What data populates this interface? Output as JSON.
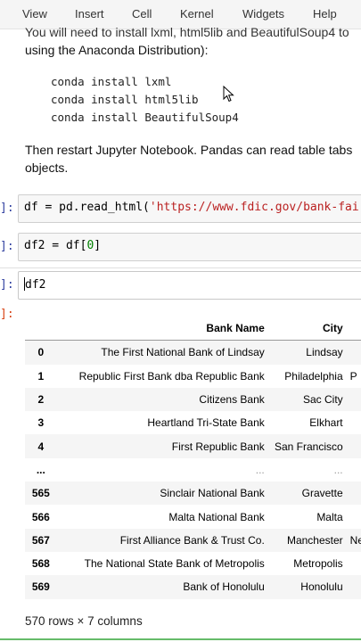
{
  "menu": [
    "View",
    "Insert",
    "Cell",
    "Kernel",
    "Widgets",
    "Help"
  ],
  "markdown": {
    "line1": "You will need to install lxml, html5lib and BeautifulSoup4 to",
    "line2": "using the Anaconda Distribution):",
    "commands": [
      "conda install lxml",
      "conda install html5lib",
      "conda install BeautifulSoup4"
    ],
    "line3": "Then restart Jupyter Notebook. Pandas can read table tabs",
    "line4": "objects."
  },
  "cells": [
    {
      "prompt": "]:",
      "code_var": "df",
      "code_mid": " = pd.read_html(",
      "code_str": "'https://www.fdic.gov/bank-fai"
    },
    {
      "prompt": "]:",
      "code_pre": "df2 = df[",
      "code_num": "0",
      "code_post": "]"
    },
    {
      "prompt": "]:",
      "code": "df2"
    }
  ],
  "output_prompt": "]:",
  "table": {
    "columns": [
      "Bank Name",
      "City"
    ],
    "rows": [
      {
        "index": "0",
        "bank": "The First National Bank of Lindsay",
        "city": "Lindsay",
        "extra": ""
      },
      {
        "index": "1",
        "bank": "Republic First Bank dba Republic Bank",
        "city": "Philadelphia",
        "extra": "P"
      },
      {
        "index": "2",
        "bank": "Citizens Bank",
        "city": "Sac City",
        "extra": ""
      },
      {
        "index": "3",
        "bank": "Heartland Tri-State Bank",
        "city": "Elkhart",
        "extra": ""
      },
      {
        "index": "4",
        "bank": "First Republic Bank",
        "city": "San Francisco",
        "extra": ""
      },
      {
        "index": "...",
        "bank": "...",
        "city": "...",
        "extra": ""
      },
      {
        "index": "565",
        "bank": "Sinclair National Bank",
        "city": "Gravette",
        "extra": ""
      },
      {
        "index": "566",
        "bank": "Malta National Bank",
        "city": "Malta",
        "extra": ""
      },
      {
        "index": "567",
        "bank": "First Alliance Bank & Trust Co.",
        "city": "Manchester",
        "extra": "Nev"
      },
      {
        "index": "568",
        "bank": "The National State Bank of Metropolis",
        "city": "Metropolis",
        "extra": ""
      },
      {
        "index": "569",
        "bank": "Bank of Honolulu",
        "city": "Honolulu",
        "extra": ""
      }
    ]
  },
  "rowcount": "570 rows × 7 columns",
  "colors": {
    "accent": "#66bb6a",
    "prompt_in": "#303f9f",
    "string": "#ba2121"
  }
}
